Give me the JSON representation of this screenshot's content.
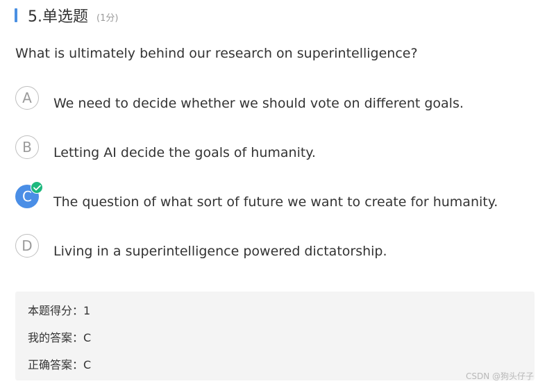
{
  "question": {
    "number_title": "5.单选题",
    "score_note": "(1分)",
    "text": "What is ultimately behind our research on superintelligence?"
  },
  "options": [
    {
      "letter": "A",
      "text": "We need to decide whether we should vote on different goals.",
      "selected": false
    },
    {
      "letter": "B",
      "text": "Letting AI decide the goals of humanity.",
      "selected": false
    },
    {
      "letter": "C",
      "text": "The question of what sort of future we want to create for humanity.",
      "selected": true
    },
    {
      "letter": "D",
      "text": "Living in a superintelligence powered dictatorship.",
      "selected": false
    }
  ],
  "result": {
    "score_line": "本题得分：1",
    "my_answer_line": "我的答案：C",
    "correct_answer_line": "正确答案：C"
  },
  "watermark": "CSDN @狗头仔子",
  "colors": {
    "accent": "#4a90e2",
    "selected_option": "#4a8ee6",
    "check_badge": "#1db87e",
    "result_bg": "#f4f4f4"
  },
  "icons": {
    "header_marker": "vertical-bar",
    "correct_mark": "check-icon"
  }
}
